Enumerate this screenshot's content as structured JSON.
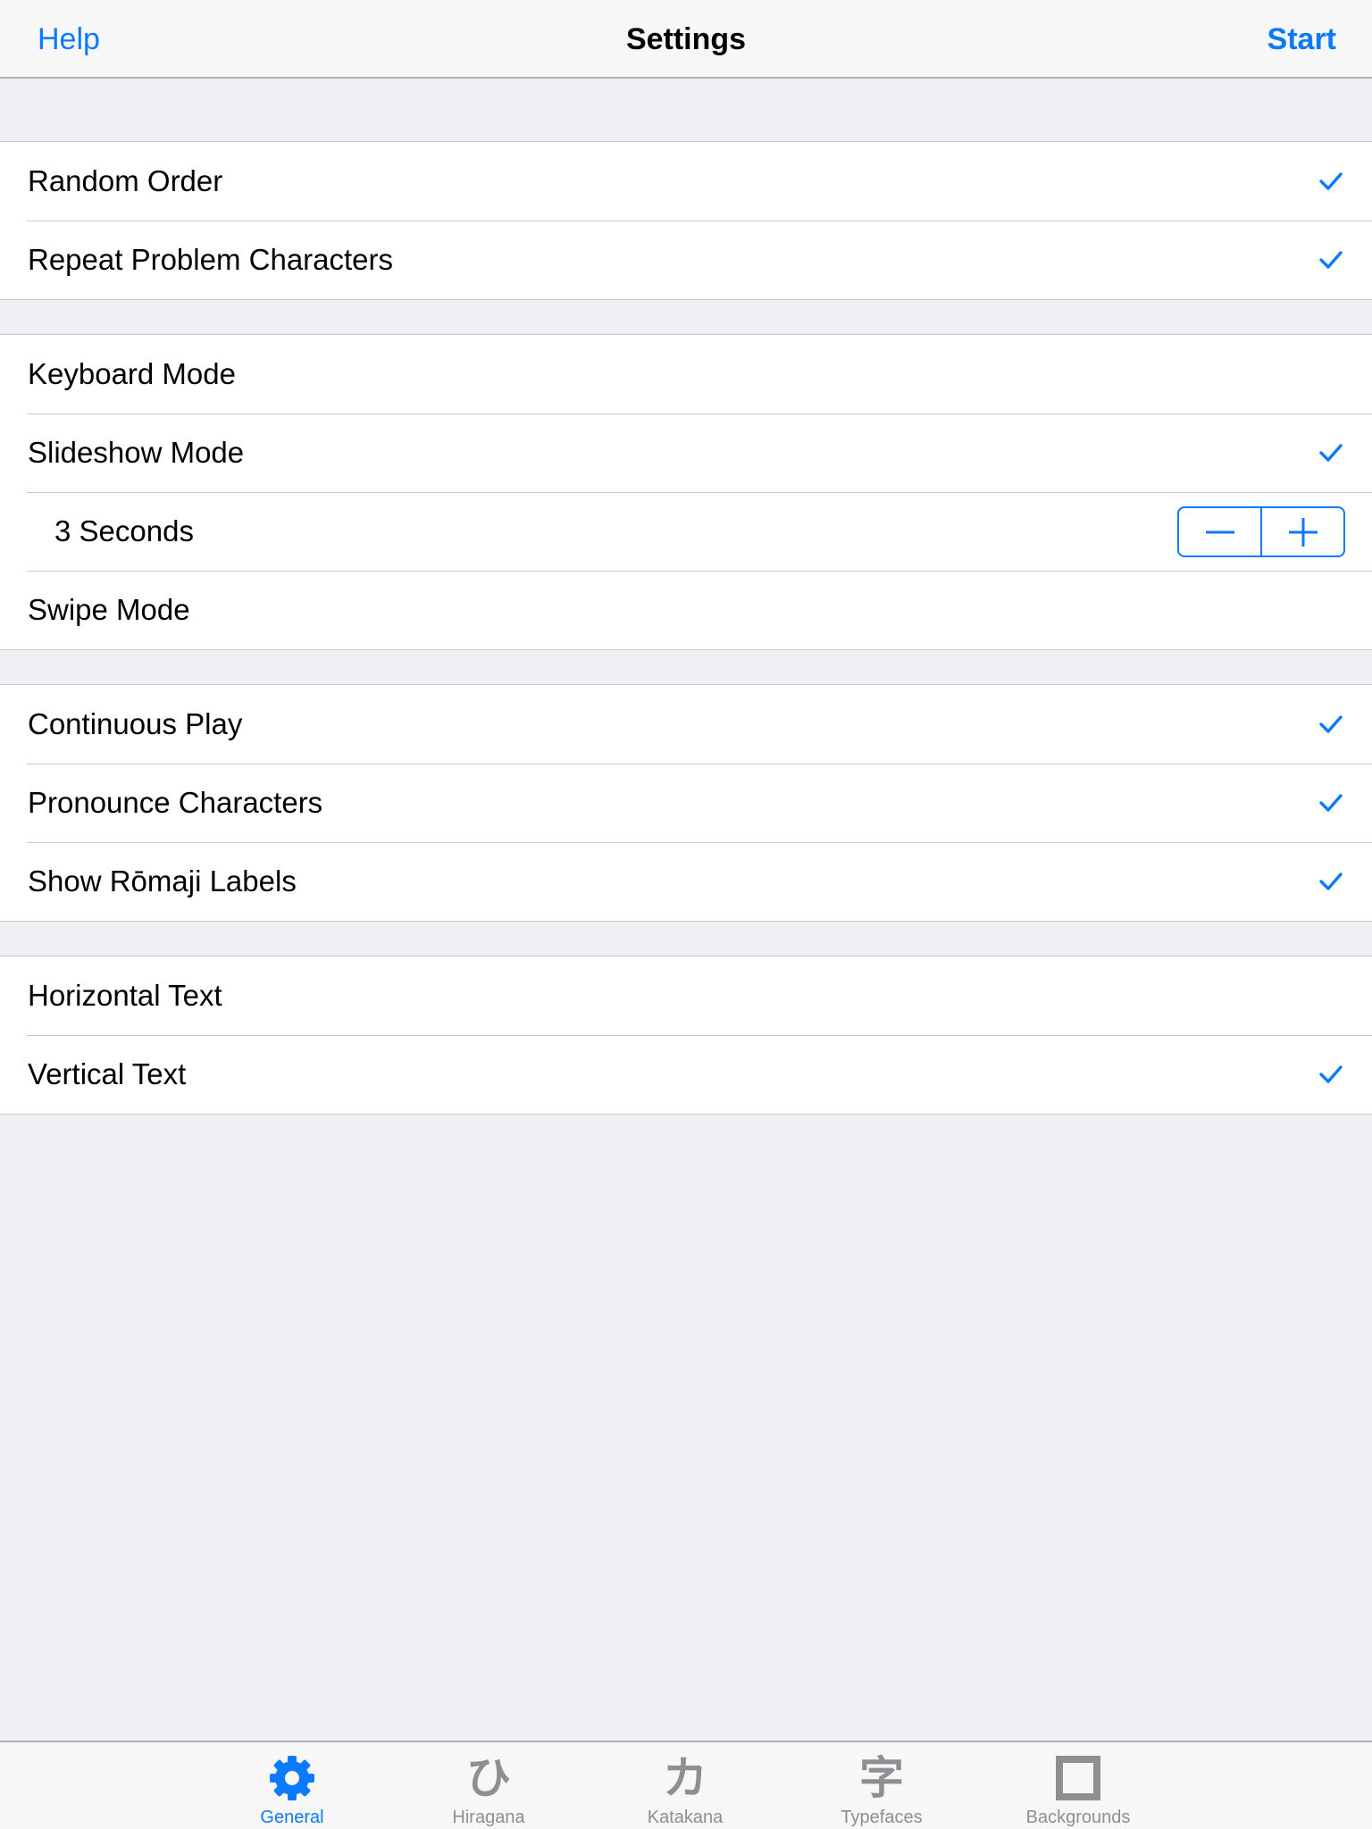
{
  "nav": {
    "left_label": "Help",
    "title": "Settings",
    "right_label": "Start"
  },
  "sections": [
    {
      "rows": [
        {
          "label": "Random Order",
          "checked": true
        },
        {
          "label": "Repeat Problem Characters",
          "checked": true
        }
      ]
    },
    {
      "rows": [
        {
          "label": "Keyboard Mode",
          "checked": false
        },
        {
          "label": "Slideshow Mode",
          "checked": true
        },
        {
          "label": "3 Seconds",
          "stepper": true
        },
        {
          "label": "Swipe Mode",
          "checked": false
        }
      ]
    },
    {
      "rows": [
        {
          "label": "Continuous Play",
          "checked": true
        },
        {
          "label": "Pronounce Characters",
          "checked": true
        },
        {
          "label": "Show Rōmaji Labels",
          "checked": true
        }
      ]
    },
    {
      "rows": [
        {
          "label": "Horizontal Text",
          "checked": false
        },
        {
          "label": "Vertical Text",
          "checked": true
        }
      ]
    }
  ],
  "stepper": {
    "decrement_icon": "minus-icon",
    "increment_icon": "plus-icon"
  },
  "tabs": [
    {
      "label": "General",
      "icon": "gear-icon",
      "active": true
    },
    {
      "label": "Hiragana",
      "icon": "hiragana-hi-icon",
      "glyph": "ひ",
      "active": false
    },
    {
      "label": "Katakana",
      "icon": "katakana-ka-icon",
      "glyph": "カ",
      "active": false
    },
    {
      "label": "Typefaces",
      "icon": "kanji-ji-icon",
      "glyph": "字",
      "active": false
    },
    {
      "label": "Backgrounds",
      "icon": "square-icon",
      "active": false
    }
  ],
  "colors": {
    "accent": "#0a7aff",
    "inactive_tab": "#8e8e93",
    "background": "#efeff4"
  }
}
